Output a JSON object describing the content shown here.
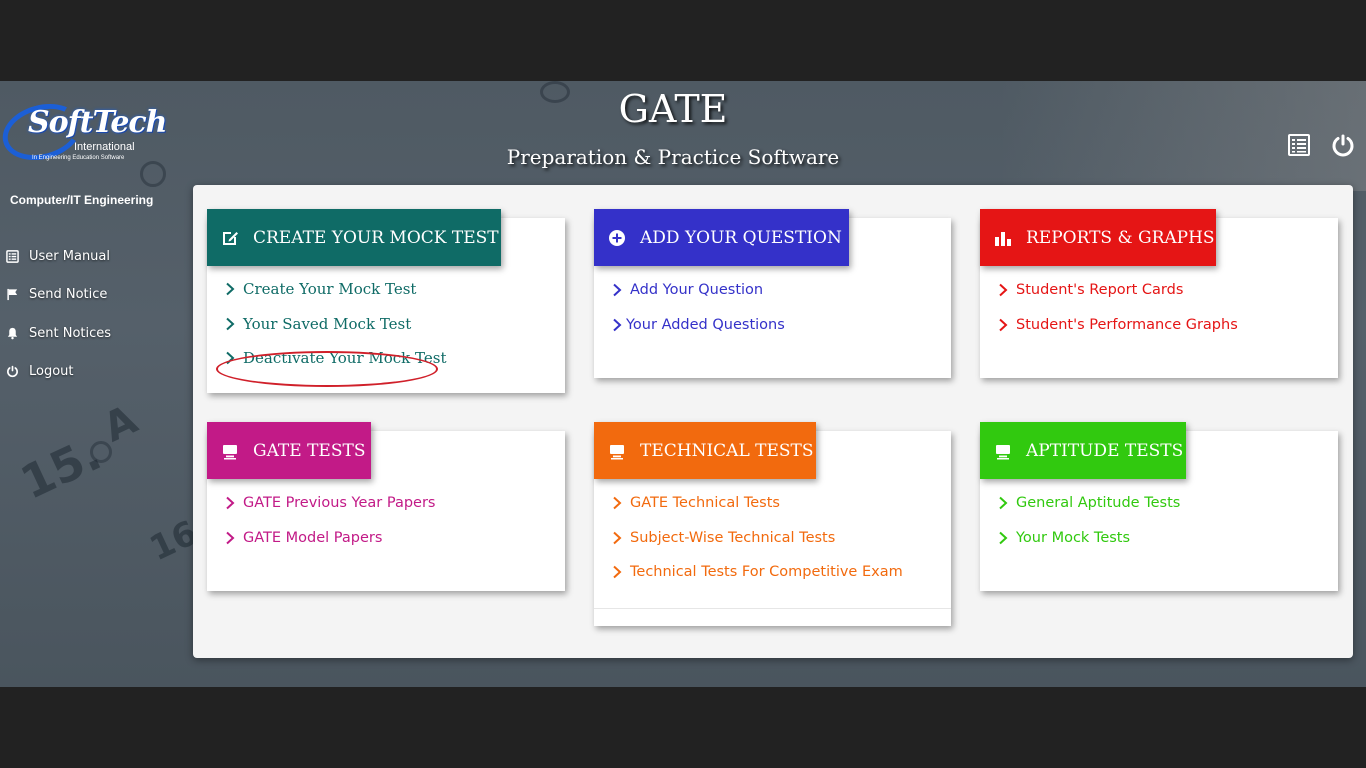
{
  "app": {
    "title": "GATE",
    "subtitle": "Preparation & Practice Software"
  },
  "logo": {
    "name": "SoftTech",
    "tagline": "International",
    "slogan": "In Engineering Education Software"
  },
  "sidebar": {
    "branch": "Computer/IT Engineering",
    "items": [
      {
        "label": "User Manual",
        "icon": "book-icon"
      },
      {
        "label": "Send Notice",
        "icon": "flag-icon"
      },
      {
        "label": "Sent Notices",
        "icon": "bell-icon"
      },
      {
        "label": "Logout",
        "icon": "power-icon"
      }
    ]
  },
  "header_icons": [
    "list-icon",
    "power-icon"
  ],
  "colors": {
    "mock": "#0f6b66",
    "question": "#3431c9",
    "reports": "#e51515",
    "gate": "#c21a87",
    "technical": "#f26a0e",
    "aptitude": "#31c90f"
  },
  "cards": {
    "mock": {
      "title": "Create Your Mock Test",
      "links": [
        "Create Your Mock Test",
        "Your Saved Mock Test",
        "Deactivate Your Mock Test"
      ]
    },
    "question": {
      "title": "Add Your Question",
      "links": [
        "Add Your Question",
        "Your Added Questions"
      ]
    },
    "reports": {
      "title": "Reports & Graphs",
      "links": [
        "Student's Report Cards",
        "Student's Performance Graphs"
      ]
    },
    "gate": {
      "title": "GATE Tests",
      "links": [
        "GATE Previous Year Papers",
        "GATE Model Papers"
      ]
    },
    "technical": {
      "title": "Technical Tests",
      "links": [
        "GATE Technical Tests",
        "Subject-Wise Technical Tests",
        "Technical Tests For Competitive Exam"
      ]
    },
    "aptitude": {
      "title": "Aptitude Tests",
      "links": [
        "General Aptitude Tests",
        "Your Mock Tests"
      ]
    }
  }
}
